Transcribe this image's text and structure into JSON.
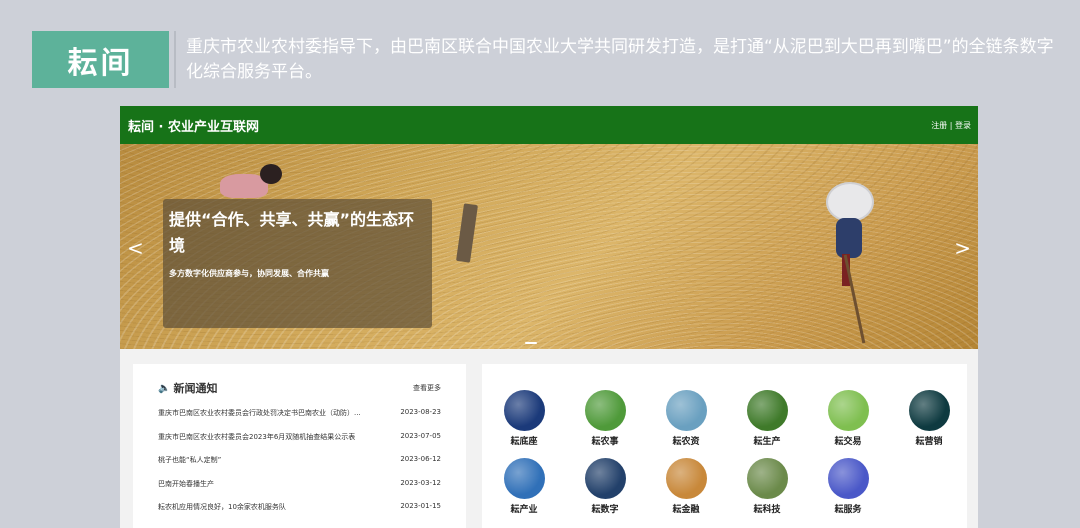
{
  "header": {
    "badge": "耘间",
    "description": "重庆市农业农村委指导下，由巴南区联合中国农业大学共同研发打造，是打通“从泥巴到大巴再到嘴巴”的全链条数字化综合服务平台。"
  },
  "site": {
    "title": "耘间 · 农业产业互联网",
    "auth": "注册 | 登录"
  },
  "banner": {
    "heading": "提供“合作、共享、共赢”的生态环境",
    "subheading": "多方数字化供应商参与，协同发展、合作共赢",
    "prev": "<",
    "next": ">"
  },
  "news": {
    "title": "新闻通知",
    "more": "查看更多",
    "items": [
      {
        "title": "重庆市巴南区农业农村委员会行政处罚决定书巴南农业（动防）...",
        "date": "2023-08-23"
      },
      {
        "title": "重庆市巴南区农业农村委员会2023年6月双随机抽查结果公示表",
        "date": "2023-07-05"
      },
      {
        "title": "桃子也能“私人定制”",
        "date": "2023-06-12"
      },
      {
        "title": "巴南开始春播生产",
        "date": "2023-03-12"
      },
      {
        "title": "耘农机应用情况良好，10余家农机服务队",
        "date": "2023-01-15"
      }
    ]
  },
  "apps": [
    {
      "label": "耘底座",
      "color": "#1b3a7a"
    },
    {
      "label": "耘农事",
      "color": "#4f9a3a"
    },
    {
      "label": "耘农资",
      "color": "#6aa0c0"
    },
    {
      "label": "耘生产",
      "color": "#3f7a2a"
    },
    {
      "label": "耘交易",
      "color": "#7fbf50"
    },
    {
      "label": "耘营销",
      "color": "#0e3a40"
    },
    {
      "label": "耘产业",
      "color": "#3070b8"
    },
    {
      "label": "耘数字",
      "color": "#22406a"
    },
    {
      "label": "耘金融",
      "color": "#c8883a"
    },
    {
      "label": "耘科技",
      "color": "#6b8a4a"
    },
    {
      "label": "耘服务",
      "color": "#4a58c8"
    }
  ]
}
